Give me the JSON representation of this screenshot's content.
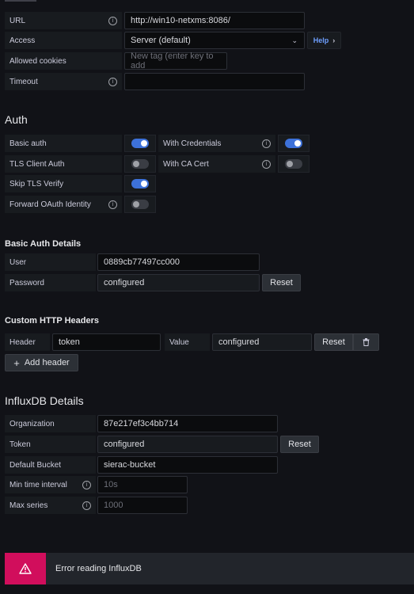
{
  "http": {
    "url_label": "URL",
    "url_value": "http://win10-netxms:8086/",
    "access_label": "Access",
    "access_value": "Server (default)",
    "help_label": "Help",
    "cookies_label": "Allowed cookies",
    "cookies_placeholder": "New tag (enter key to add",
    "timeout_label": "Timeout",
    "timeout_value": ""
  },
  "auth": {
    "title": "Auth",
    "basic_auth": {
      "label": "Basic auth",
      "on": true
    },
    "with_credentials": {
      "label": "With Credentials",
      "on": true
    },
    "tls_client_auth": {
      "label": "TLS Client Auth",
      "on": false
    },
    "with_ca_cert": {
      "label": "With CA Cert",
      "on": false
    },
    "skip_tls_verify": {
      "label": "Skip TLS Verify",
      "on": true
    },
    "forward_oauth": {
      "label": "Forward OAuth Identity",
      "on": false
    }
  },
  "basic_auth_details": {
    "title": "Basic Auth Details",
    "user_label": "User",
    "user_value": "0889cb77497cc000",
    "password_label": "Password",
    "password_value": "configured",
    "reset_label": "Reset"
  },
  "custom_headers": {
    "title": "Custom HTTP Headers",
    "header_label": "Header",
    "header_value": "token",
    "value_label": "Value",
    "value_value": "configured",
    "reset_label": "Reset",
    "add_header_label": "Add header"
  },
  "influxdb": {
    "title": "InfluxDB Details",
    "org_label": "Organization",
    "org_value": "87e217ef3c4bb714",
    "token_label": "Token",
    "token_value": "configured",
    "token_reset_label": "Reset",
    "bucket_label": "Default Bucket",
    "bucket_value": "sierac-bucket",
    "min_interval_label": "Min time interval",
    "min_interval_placeholder": "10s",
    "max_series_label": "Max series",
    "max_series_placeholder": "1000"
  },
  "alert": {
    "message": "Error reading InfluxDB"
  },
  "colors": {
    "background": "#111217",
    "toggle_on": "#3d71d9",
    "alert_icon_bg": "#d10e5c",
    "link": "#6e9fff"
  }
}
